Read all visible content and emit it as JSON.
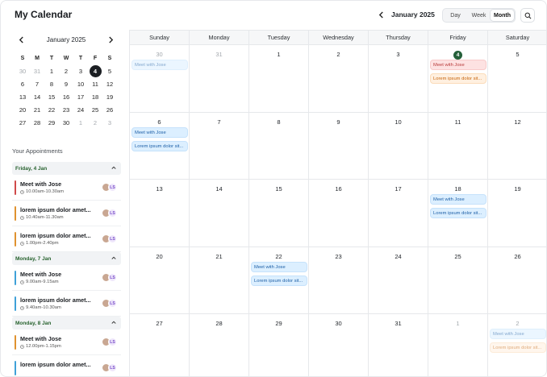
{
  "header": {
    "title": "My Calendar",
    "month_label": "January 2025",
    "views": [
      "Day",
      "Week",
      "Month"
    ],
    "active_view": "Month"
  },
  "mini_calendar": {
    "title": "January 2025",
    "weekdays": [
      "S",
      "M",
      "T",
      "W",
      "T",
      "F",
      "S"
    ],
    "days": [
      {
        "d": "30",
        "dim": true
      },
      {
        "d": "31",
        "dim": true
      },
      {
        "d": "1"
      },
      {
        "d": "2"
      },
      {
        "d": "3"
      },
      {
        "d": "4",
        "today": true
      },
      {
        "d": "5"
      },
      {
        "d": "6"
      },
      {
        "d": "7"
      },
      {
        "d": "8"
      },
      {
        "d": "9"
      },
      {
        "d": "10"
      },
      {
        "d": "11"
      },
      {
        "d": "12"
      },
      {
        "d": "13"
      },
      {
        "d": "14"
      },
      {
        "d": "15"
      },
      {
        "d": "16"
      },
      {
        "d": "17"
      },
      {
        "d": "18"
      },
      {
        "d": "19"
      },
      {
        "d": "20"
      },
      {
        "d": "21"
      },
      {
        "d": "22"
      },
      {
        "d": "23"
      },
      {
        "d": "24"
      },
      {
        "d": "25"
      },
      {
        "d": "26"
      },
      {
        "d": "27"
      },
      {
        "d": "28"
      },
      {
        "d": "29"
      },
      {
        "d": "30"
      },
      {
        "d": "1",
        "dim": true
      },
      {
        "d": "2",
        "dim": true
      },
      {
        "d": "3",
        "dim": true
      }
    ]
  },
  "appointments": {
    "title": "Your Appointments",
    "avatar_initials": "LS",
    "groups": [
      {
        "label": "Friday, 4 Jan",
        "items": [
          {
            "title": "Meet with Jose",
            "time": "10.00am-10.30am",
            "color": "#d04a4a"
          },
          {
            "title": "lorem ipsum dolor amet...",
            "time": "10.40am-11.30am",
            "color": "#e0922f"
          },
          {
            "title": "lorem ipsum dolor amet...",
            "time": "1.00pm-2.40pm",
            "color": "#e0922f"
          }
        ]
      },
      {
        "label": "Monday, 7 Jan",
        "items": [
          {
            "title": "Meet with Jose",
            "time": "9.00am-9.15am",
            "color": "#3fa1d8"
          },
          {
            "title": "lorem ipsum dolor amet...",
            "time": "9.40am-10.30am",
            "color": "#3fa1d8"
          }
        ]
      },
      {
        "label": "Monday, 8 Jan",
        "items": [
          {
            "title": "Meet with Jose",
            "time": "12.00pm-1.15pm",
            "color": "#e0922f"
          },
          {
            "title": "lorem ipsum dolor amet...",
            "time": "",
            "color": "#3fa1d8"
          }
        ]
      }
    ]
  },
  "calendar": {
    "weekdays": [
      "Sunday",
      "Monday",
      "Tuesday",
      "Wednesday",
      "Thursday",
      "Friday",
      "Saturday"
    ],
    "weeks": [
      [
        {
          "d": "30",
          "dim": true,
          "events": [
            {
              "text": "Meet with Jose",
              "color": "blue",
              "faded": true
            }
          ]
        },
        {
          "d": "31",
          "dim": true,
          "events": []
        },
        {
          "d": "1",
          "events": []
        },
        {
          "d": "2",
          "events": []
        },
        {
          "d": "3",
          "events": []
        },
        {
          "d": "4",
          "today": true,
          "events": [
            {
              "text": "Meet with Jose",
              "color": "red"
            },
            {
              "text": "Lorem ipsum dolor sit...",
              "color": "orange"
            }
          ]
        },
        {
          "d": "5",
          "events": []
        }
      ],
      [
        {
          "d": "6",
          "events": [
            {
              "text": "Meet with Jose",
              "color": "blue"
            },
            {
              "text": "Lorem ipsum dolor sit...",
              "color": "blue"
            }
          ]
        },
        {
          "d": "7",
          "events": []
        },
        {
          "d": "8",
          "events": []
        },
        {
          "d": "9",
          "events": []
        },
        {
          "d": "10",
          "events": []
        },
        {
          "d": "11",
          "events": []
        },
        {
          "d": "12",
          "events": []
        }
      ],
      [
        {
          "d": "13",
          "events": []
        },
        {
          "d": "14",
          "events": []
        },
        {
          "d": "15",
          "events": []
        },
        {
          "d": "16",
          "events": []
        },
        {
          "d": "17",
          "events": []
        },
        {
          "d": "18",
          "events": [
            {
              "text": "Meet with Jose",
              "color": "blue"
            },
            {
              "text": "Lorem ipsum dolor sit...",
              "color": "blue"
            }
          ]
        },
        {
          "d": "19",
          "events": []
        }
      ],
      [
        {
          "d": "20",
          "events": []
        },
        {
          "d": "21",
          "events": []
        },
        {
          "d": "22",
          "events": [
            {
              "text": "Meet with Jose",
              "color": "blue"
            },
            {
              "text": "Lorem ipsum dolor sit...",
              "color": "blue"
            }
          ]
        },
        {
          "d": "23",
          "events": []
        },
        {
          "d": "24",
          "events": []
        },
        {
          "d": "25",
          "events": []
        },
        {
          "d": "26",
          "events": []
        }
      ],
      [
        {
          "d": "27",
          "events": []
        },
        {
          "d": "28",
          "events": []
        },
        {
          "d": "29",
          "events": []
        },
        {
          "d": "30",
          "events": []
        },
        {
          "d": "31",
          "events": []
        },
        {
          "d": "1",
          "dim": true,
          "events": []
        },
        {
          "d": "2",
          "dim": true,
          "events": [
            {
              "text": "Meet with Jose",
              "color": "blue",
              "faded": true
            },
            {
              "text": "Lorem ipsum dolor sit...",
              "color": "orange",
              "faded": true
            }
          ]
        }
      ]
    ]
  }
}
